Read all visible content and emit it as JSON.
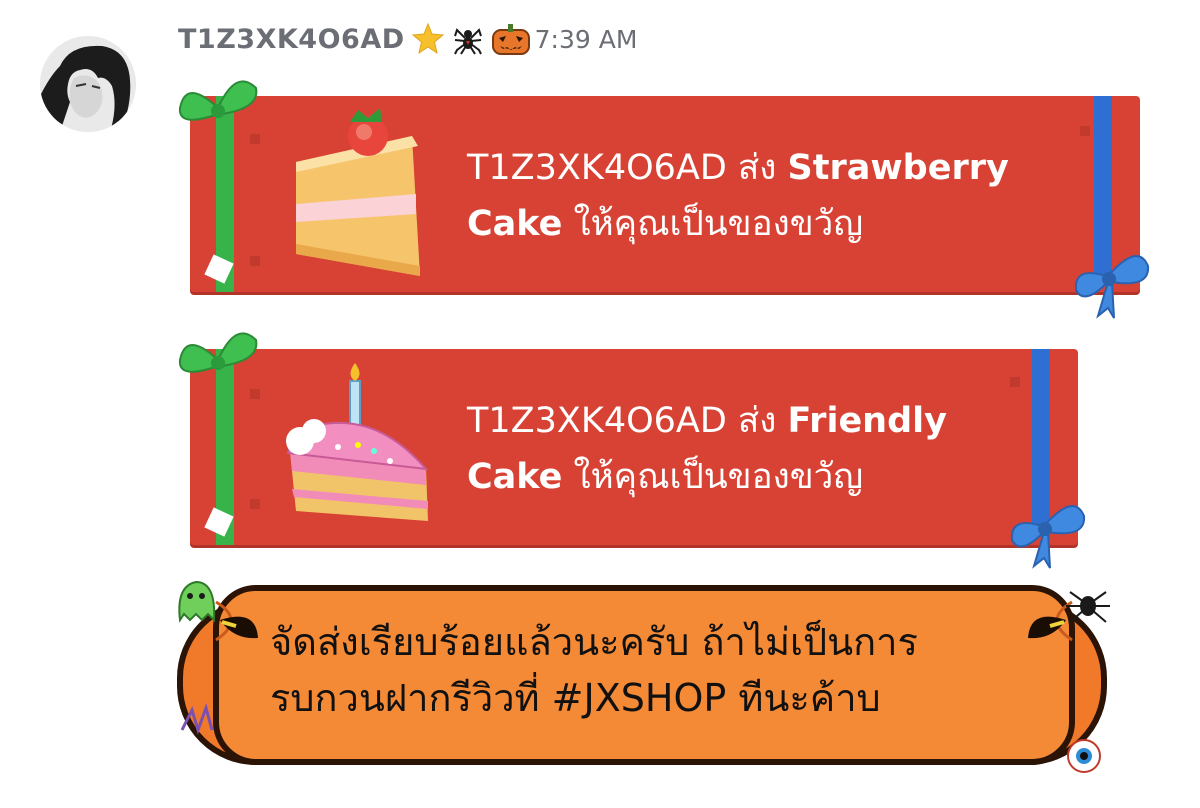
{
  "message": {
    "username": "T1Z3XK4O6AD",
    "badges": [
      "star-icon",
      "spider-icon",
      "pumpkin-icon"
    ],
    "timestamp": "7:39 AM"
  },
  "gifts": [
    {
      "line1_prefix": "T1Z3XK4O6AD ส่ง ",
      "line1_item": "Strawberry",
      "line2_item": "Cake",
      "line2_suffix": " ให้คุณเป็นของขวัญ",
      "icon": "strawberry-cake-icon"
    },
    {
      "line1_prefix": "T1Z3XK4O6AD ส่ง ",
      "line1_item": "Friendly",
      "line2_item": "Cake",
      "line2_suffix": " ให้คุณเป็นของขวัญ",
      "icon": "friendly-cake-icon"
    }
  ],
  "sticker": {
    "line1": "จัดส่งเรียบร้อยแล้วนะครับ ถ้าไม่เป็นการ",
    "line2": "รบกวนฝากรีวิวที่ #JXSHOP ทีนะค้าบ",
    "theme": "halloween-pumpkin"
  },
  "colors": {
    "gift_red": "#d84234",
    "ribbon_green": "#37b34a",
    "ribbon_blue": "#2e6fd1",
    "pumpkin_orange": "#f07a2a",
    "username_gray": "#6b6e75"
  }
}
